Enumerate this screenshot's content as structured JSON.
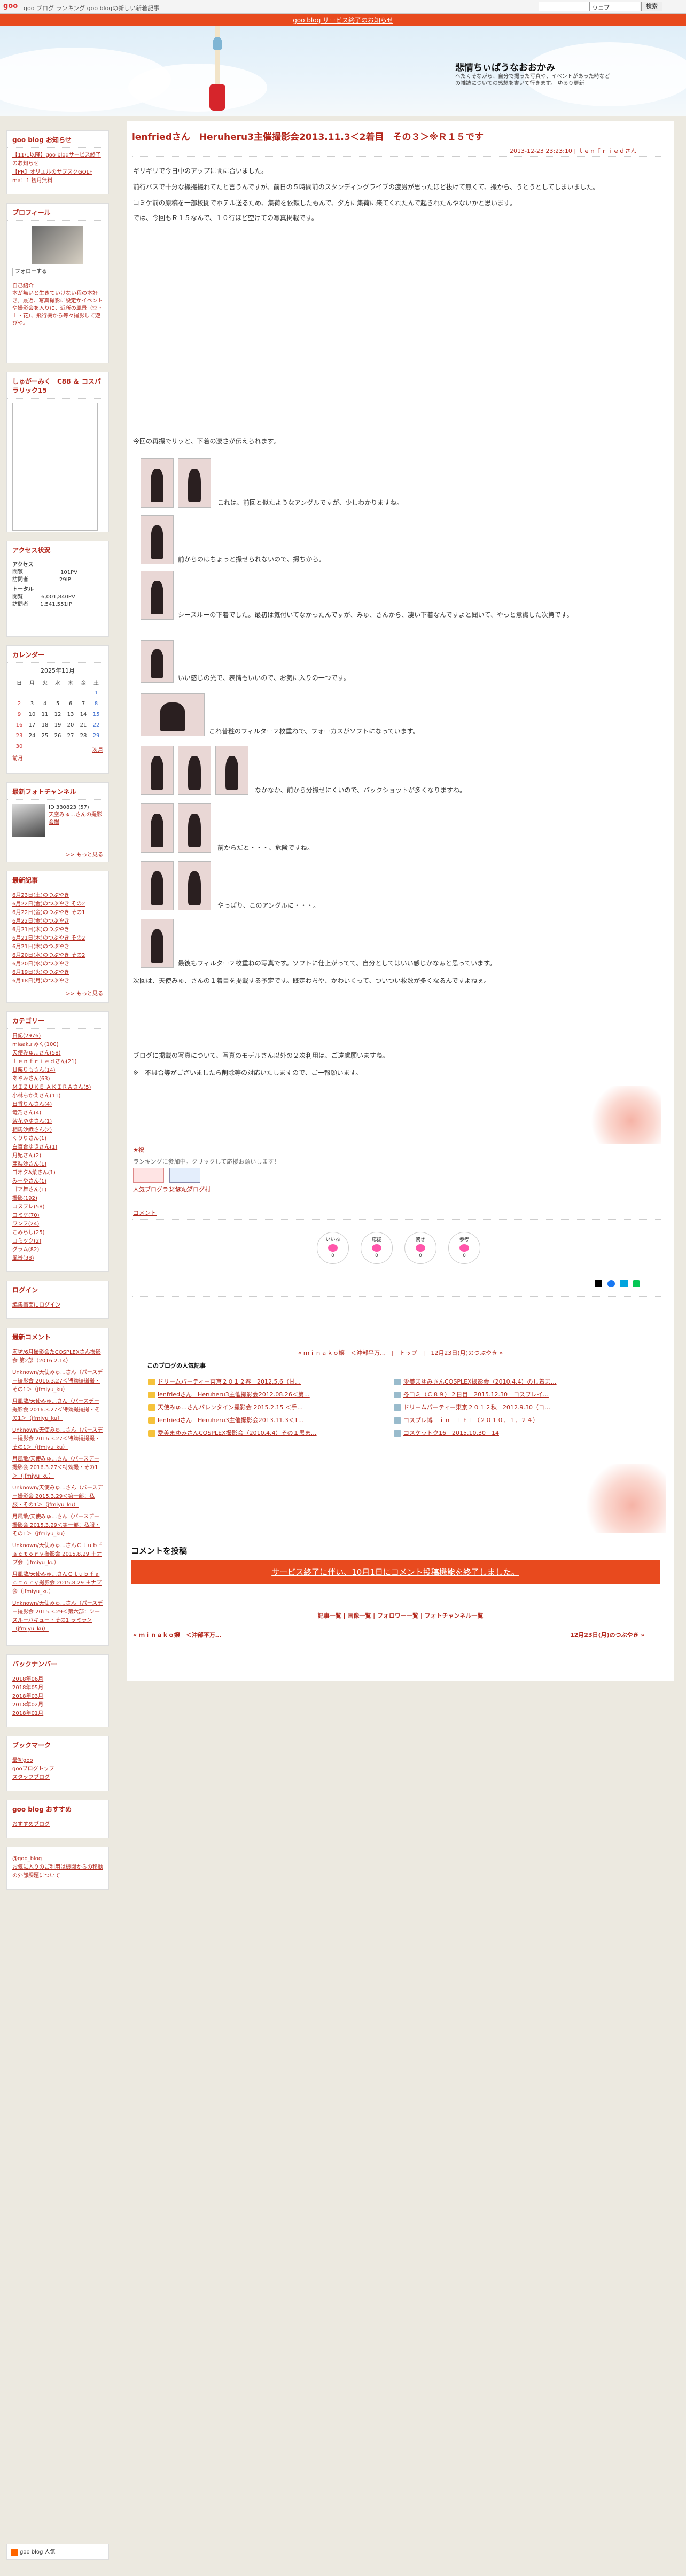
{
  "topbar": {
    "links": "goo ブログ ランキング goo blogの新しい新着記事",
    "search_placeholder": "",
    "search_option": "ウェブ",
    "search_button": "検索"
  },
  "notice": "goo blog サービス終了のお知らせ",
  "header": {
    "blog_title": "悲情ちぃぱうなおおかみ",
    "blog_desc": "ヘたくそながら、自分で撮った写真や、イベントがあった時などの雑誌についての感想を書いて行きます。 ゆるり更新"
  },
  "sidebar": {
    "notice": {
      "title": "goo blog お知らせ",
      "items": [
        "【11/1以降】goo blogサービス終了のお知らせ",
        "【PR】オリエルのサブスクGOLF ma！1 初月無料"
      ]
    },
    "profile": {
      "title": "プロフィール",
      "follow": "フォローする",
      "label": "自己紹介",
      "text": "本が無いと生きていけない程の本好き。最近、写真撮影に設定かイベントや撮影会を入りに、近所の風景（空・山・花）、飛行機から等々撮影して遊びや。"
    },
    "box3": {
      "title": "しゅがーみく　C88 ＆ コスパラリック15"
    },
    "access": {
      "title": "アクセス状況",
      "sub": "アクセス",
      "rows": [
        [
          "閲覧",
          "101PV"
        ],
        [
          "訪問者",
          "29IP"
        ]
      ],
      "total": "トータル",
      "trows": [
        [
          "閲覧",
          "6,001,840PV"
        ],
        [
          "訪問者",
          "1,541,551IP"
        ]
      ]
    },
    "calendar": {
      "title": "カレンダー",
      "month": "2025年11月",
      "week": [
        "日",
        "月",
        "火",
        "水",
        "木",
        "金",
        "土"
      ],
      "days": [
        "",
        "",
        "",
        "",
        "",
        "",
        "1",
        "2",
        "3",
        "4",
        "5",
        "6",
        "7",
        "8",
        "9",
        "10",
        "11",
        "12",
        "13",
        "14",
        "15",
        "16",
        "17",
        "18",
        "19",
        "20",
        "21",
        "22",
        "23",
        "24",
        "25",
        "26",
        "27",
        "28",
        "29",
        "30"
      ],
      "prev": "前月",
      "next": "次月"
    },
    "photo": {
      "title": "最新フォトチャンネル",
      "count": "ID 330823 (57)",
      "name": "天空みゅ…さんの撮影会撮",
      "more": ">> もっと見る"
    },
    "recent": {
      "title": "最新記事",
      "items": [
        "6月23日(土)のつぶやき",
        "6月22日(金)のつぶやき その2",
        "6月22日(金)のつぶやき その1",
        "6月22日(金)のつぶやき",
        "6月21日(木)のつぶやき",
        "6月21日(木)のつぶやき その2",
        "6月21日(木)のつぶやき",
        "6月20日(水)のつぶやき その2",
        "6月20日(水)のつぶやき",
        "6月19日(火)のつぶやき",
        "6月18日(月)のつぶやき"
      ],
      "more": ">> もっと見る"
    },
    "category": {
      "title": "カテゴリー",
      "items": [
        "日記(2976)",
        "miaaku·みく(100)",
        "天使みゅ…さん(58)",
        "ｌｅｎｆｒｉｅｄさん(21)",
        "甘栗りもさん(14)",
        "あやみさん(63)",
        "ＭＩＺＵＫＥ ＡＫＩＲＡさん(5)",
        "小林ちかえさん(11)",
        "日香りんさん(4)",
        "竜乃さん(4)",
        "紫花ゆゆさん(1)",
        "相馬沙織さん(2)",
        "くりりさん(1)",
        "白百合ゆきさん(1)",
        "月妃さん(2)",
        "亜梨沙さん(1)",
        "ゴオクA菜さん(1)",
        "みーやさん(1)",
        "ゴア舞さん(1)",
        "撮影(192)",
        "コスプレ(58)",
        "コミケ(70)",
        "ワンフ(24)",
        "こみらし(25)",
        "コミック(2)",
        "グラム(82)",
        "風景(38)"
      ]
    },
    "login": {
      "title": "ログイン",
      "link": "編集画面にログイン"
    },
    "comments": {
      "title": "最新コメント",
      "items": [
        "海坊/6月撮影会たCOSPLEXさん撮影会 第2部（2016.2.14）",
        "Unknown/天使みゅ…さん（パースデー撮影会 2016.3.27＜特効撮撮撮・その1＞（jfmiyu_ku）",
        "月風散/天使みゅ…さん（パースデー撮影会 2016.3.27＜特効撮撮撮・その1＞（jfmiyu_ku）",
        "Unknown/天使みゅ…さん（パースデー撮影会 2016.3.27＜特効撮撮撮・その1＞（jfmiyu_ku）",
        "月風散/天使みゅ…さん（パースデー撮影会 2016.3.27＜特効撮・その1＞（jfmiyu_ku）",
        "Unknown/天使みゅ…さん（パースデー撮影会 2015.3.29＜第一部：私服・その1＞（jfmiyu_ku）",
        "月風散/天使みゅ…さん（パースデー撮影会 2015.3.29＜第一部：私服・その1＞（jfmiyu_ku）",
        "Unknown/天使みゅ…さんＣｌｕｂｆａｃｔｏｒｙ撮影会 2015.8.29 ＋ナプ会（jfmiyu_ku）",
        "月風散/天使みゅ…さんＣｌｕｂｆａｃｔｏｒｙ撮影会 2015.8.29 ＋ナプ会（jfmiyu_ku）",
        "Unknown/天使みゅ…さん（パースデー撮影会 2015.3.29＜第六部：シースルーバキュー・その1 ラミラ＞（jfmiyu_ku）"
      ]
    },
    "backnumber": {
      "title": "バックナンバー",
      "items": [
        "2018年06月",
        "2018年05月",
        "2018年03月",
        "2018年02月",
        "2018年01月"
      ]
    },
    "bookmark": {
      "title": "ブックマーク",
      "items": [
        "最初goo",
        "gooブログトップ",
        "スタッフブログ"
      ]
    },
    "osusume": {
      "title": "goo blog おすすめ",
      "link": "おすすめブログ"
    },
    "share": {
      "handle": "@goo_blog",
      "text": "お気に入りのご利用は機関からの移動の外部課題について"
    },
    "foot": "goo blog 人気"
  },
  "post": {
    "title": "lenfriedさん　Heruheru3主催撮影会2013.11.3＜2着目　その３＞※Ｒ１５です",
    "meta": "2013-12-23 23:23:10 | ｌｅｎｆｒｉｅｄさん",
    "p1": "ギリギリで今日中のアップに間に合いました。",
    "p2": "前行バスで十分な撮撮撮れてたと言うんですが、前日の５時間前のスタンディングライブの疲労が思ったほど抜けて無くて、撮から、うとうとしてしまいました。",
    "p3": "コミケ前の原稿を一部校閲でホテル送るため、集荷を依頼したもんで、夕方に集荷に来てくれたんで起きれたんやないかと思います。",
    "p4": "では、今回もＲ１５なんで、１０行ほど空けての写真掲載です。",
    "p5": "今回の再撮でサッと、下着の凄さが伝えられます。",
    "c1": "これは、前回と似たようなアングルですが、少しわかりますね。",
    "c2": "前からのはちょっと撮せられないので、撮ちから。",
    "c3": "シースルーの下着でした。最初は気付いてなかったんですが、みゅ、さんから、凄い下着なんですよと聞いて、やっと意識した次第です。",
    "c4": "いい感じの光で、表情もいいので、お気に入りの一つです。",
    "c5": "これ昔粧のフィルター２枚重ねで、フォーカスがソフトになっています。",
    "c6": "なかなか、前から分撮せにくいので、バックショットが多くなりますね。",
    "c7": "前からだと・・・、危険ですね。",
    "c8": "やっぱり、このアングルに・・・。",
    "c9": "最後もフィルター２枚重ねの写真です。ソフトに仕上がってて、自分としてはいい感じかなぁと思っています。",
    "p6": "次回は、天使みゅ、さんの１着目を掲載する予定です。既定わちや、かわいくって、ついつい枚数が多くなるんですよねぇ。",
    "p7": "ブログに掲載の写真について、写真のモデルさん以外の２次利用は、ご遠慮願いますね。",
    "p8": "※　不具合等がございましたら削除等の対応いたしますので、ご一報願います。",
    "mark": "★祝",
    "ranking": "ランキングに参加中。クリックして応援お願いします！",
    "rank1": "人気ブログランキング",
    "rank2": "にほんブログ村",
    "comment_link": "コメント",
    "reactions": [
      {
        "label": "いいね",
        "count": "0"
      },
      {
        "label": "応援",
        "count": "0"
      },
      {
        "label": "驚き",
        "count": "0"
      },
      {
        "label": "参考",
        "count": "0"
      }
    ],
    "nav": "« ｍｉｎａｋｏ嬢　＜沖部平万…　|　トップ　|　12月23日(月)のつぶやき »",
    "popular_title": "このブログの人気記事",
    "popular": [
      "ドリームパーティー東京２０１２春　2012.5.6（甘…",
      "lenfriedさん　Heruheru3主催撮影会2012.08.26＜第…",
      "天使みゅ…さんバレンタイン撮影会 2015.2.15 ＜手…",
      "lenfriedさん　Heruheru3主催撮影会2013.11.3＜1…",
      "愛美まゆみさんCOSPLEX撮影会（2010.4.4）その１黒ま…",
      "愛美まゆみさんCOSPLEX撮影会（2010.4.4）のし着ま…",
      "冬コミ（Ｃ８９）２日目　2015.12.30　コスプレイ…",
      "ドリームパーティー東京２０１２秋　2012.9.30（コ…",
      "コスプレ博　ｉｎ　ＴＦＴ（２０１０．１．２４）",
      "コスケットク16　2015.10.30　14"
    ],
    "comment_heading": "コメントを投稿",
    "comment_notice": "サービス終了に伴い、10月1日にコメント投稿機能を終了しました。",
    "footer_links": "記事一覧 | 画像一覧 | フォロワー一覧 | フォトチャンネル一覧",
    "prev": "« ｍｉｎａｋｏ嬢　＜沖部平万…",
    "next": "12月23日(月)のつぶやき »"
  }
}
